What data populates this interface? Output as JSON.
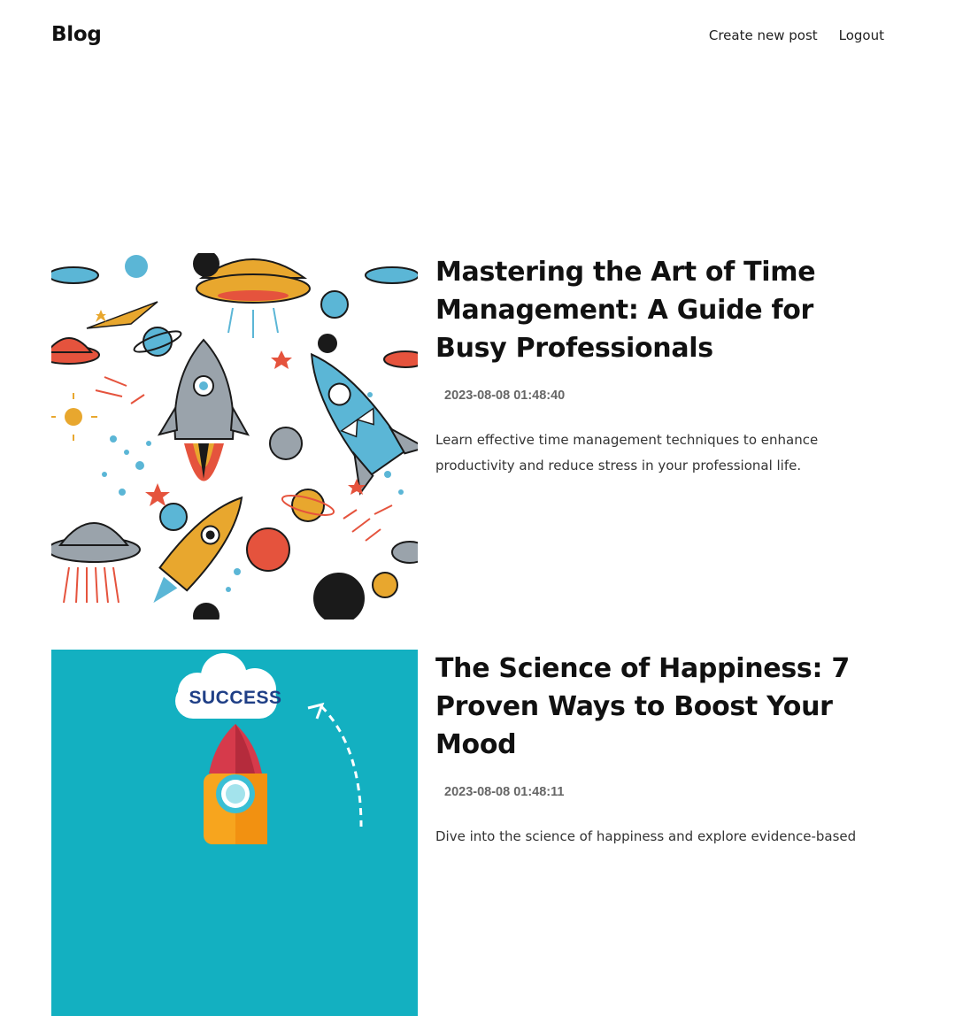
{
  "header": {
    "logo": "Blog",
    "nav": {
      "create": "Create new post",
      "logout": "Logout"
    }
  },
  "posts": [
    {
      "title": "Mastering the Art of Time Management: A Guide for Busy Professionals",
      "date": "2023-08-08 01:48:40",
      "excerpt": "Learn effective time management techniques to enhance productivity and reduce stress in your professional life.",
      "image": {
        "subject": "space doodle pattern: rockets, ufos, planets, stars",
        "colors": [
          "#5bb6d6",
          "#e5533d",
          "#e8a72e",
          "#9aa3ab",
          "#1a1a1a"
        ]
      }
    },
    {
      "title": "The Science of Happiness: 7 Proven Ways to Boost Your Mood",
      "date": "2023-08-08 01:48:11",
      "excerpt": "Dive into the science of happiness and explore evidence-based",
      "image": {
        "subject": "rocket launching toward a cloud",
        "cloud_text": "SUCCESS",
        "colors": [
          "#13b0c1",
          "#f7a51e",
          "#d63a4b",
          "#ffffff",
          "#1f3f86"
        ]
      }
    }
  ]
}
